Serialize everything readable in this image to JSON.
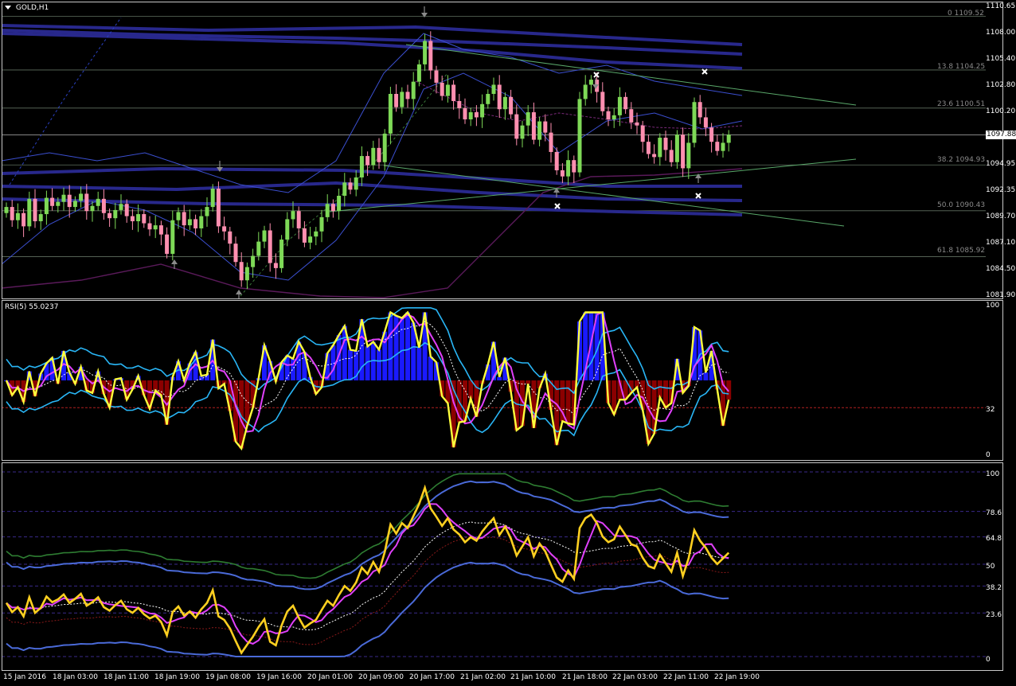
{
  "chart_window": {
    "symbol_timeframe": "GOLD,H1",
    "current_price": "1097.88"
  },
  "price_axis": {
    "labels": [
      "1110.65",
      "1108.00",
      "1105.40",
      "1102.80",
      "1100.20",
      "1094.95",
      "1092.35",
      "1089.70",
      "1087.10",
      "1084.50",
      "1081.90"
    ]
  },
  "fibonacci": {
    "levels": [
      "0 1109.52",
      "13.8 1104.25",
      "23.6 1100.51",
      "38.2 1094.93",
      "50.0 1090.43",
      "61.8 1085.92"
    ]
  },
  "rsi_panel": {
    "title": "RSI(5) 55.0237",
    "axis": [
      "100",
      "32",
      "0"
    ]
  },
  "osc_panel": {
    "axis": [
      "100",
      "78.6",
      "64.8",
      "50",
      "38.2",
      "23.6",
      "0"
    ]
  },
  "time_axis": {
    "labels": [
      "15 Jan 2016",
      "18 Jan 03:00",
      "18 Jan 11:00",
      "18 Jan 19:00",
      "19 Jan 08:00",
      "19 Jan 16:00",
      "20 Jan 01:00",
      "20 Jan 09:00",
      "20 Jan 17:00",
      "21 Jan 02:00",
      "21 Jan 10:00",
      "21 Jan 18:00",
      "22 Jan 03:00",
      "22 Jan 11:00",
      "22 Jan 19:00"
    ]
  },
  "chart_data": {
    "type": "line",
    "title": "GOLD,H1",
    "ylim": [
      1081.9,
      1110.65
    ],
    "close": [
      1090.8,
      1089.5,
      1090.2,
      1088.9,
      1091.6,
      1089.4,
      1090.1,
      1091.7,
      1090.9,
      1091.3,
      1092.0,
      1090.8,
      1091.4,
      1092.1,
      1090.4,
      1090.9,
      1091.6,
      1090.2,
      1089.7,
      1090.5,
      1091.1,
      1089.9,
      1089.4,
      1090.1,
      1089.2,
      1088.6,
      1089.0,
      1088.1,
      1086.2,
      1089.5,
      1090.3,
      1089.0,
      1089.6,
      1088.7,
      1089.9,
      1090.8,
      1092.6,
      1088.9,
      1088.4,
      1087.2,
      1085.4,
      1083.6,
      1084.9,
      1086.0,
      1087.4,
      1088.5,
      1085.3,
      1084.8,
      1087.6,
      1089.6,
      1090.4,
      1088.7,
      1087.3,
      1087.9,
      1088.4,
      1089.8,
      1091.1,
      1090.4,
      1091.9,
      1093.2,
      1092.5,
      1093.7,
      1095.8,
      1094.9,
      1096.6,
      1095.2,
      1098.0,
      1101.9,
      1100.6,
      1102.1,
      1101.4,
      1103.1,
      1104.8,
      1107.1,
      1104.2,
      1103.0,
      1101.7,
      1102.8,
      1101.2,
      1100.5,
      1099.4,
      1100.1,
      1099.6,
      1100.9,
      1101.9,
      1102.8,
      1100.4,
      1101.6,
      1099.9,
      1097.5,
      1098.8,
      1100.1,
      1097.4,
      1099.2,
      1098.1,
      1096.2,
      1094.4,
      1093.8,
      1095.4,
      1094.2,
      1101.4,
      1102.8,
      1103.3,
      1102.1,
      1100.2,
      1099.4,
      1099.8,
      1101.6,
      1100.4,
      1099.1,
      1098.8,
      1097.2,
      1096.0,
      1095.7,
      1097.6,
      1096.4,
      1095.2,
      1097.9,
      1094.6,
      1097.1,
      1101.1,
      1099.6,
      1098.6,
      1097.2,
      1096.3,
      1097.1,
      1097.9
    ]
  },
  "colors": {
    "bull_candle": "#7ed957",
    "bear_candle": "#ff8fb0",
    "rsi_line": "#ffff3c",
    "fib_line": "#607060",
    "band_blue": "#28288c",
    "trend_line": "#5aa86a",
    "rsi_pos_hist": "#1a1aff",
    "rsi_neg_hist": "#8b0000",
    "osc_main": "#ffd020",
    "osc_green": "#2e7d32"
  }
}
